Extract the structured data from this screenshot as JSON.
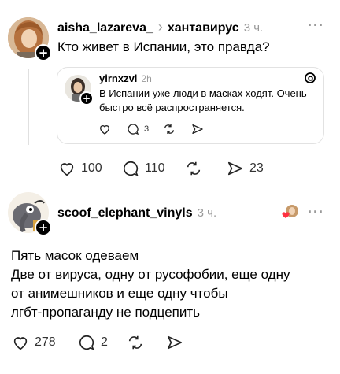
{
  "post1": {
    "username": "aisha_lazareva_",
    "chevron": "›",
    "topic": "хантавирус",
    "time": "3 ч.",
    "text": "Кто живет в Испании, это правда?",
    "actions": {
      "likes": "100",
      "replies": "110",
      "shares": "23"
    }
  },
  "quoted": {
    "username": "yirnxzvl",
    "time": "2h",
    "text": "В Испании уже люди в масках ходят. Очень быстро всё распространяется.",
    "actions": {
      "replies": "3"
    }
  },
  "post2": {
    "username": "scoof_elephant_vinyls",
    "time": "3 ч.",
    "text_lines": [
      "Пять масок одеваем",
      "Две от вируса, одну от русофобии, еще одну",
      "от анимешников и еще одну чтобы",
      "лгбт-пропаганду не подцепить"
    ],
    "actions": {
      "likes": "278",
      "replies": "2"
    }
  },
  "colors": {
    "like_badge": "#ff3040",
    "muted": "#9a9a9a"
  }
}
